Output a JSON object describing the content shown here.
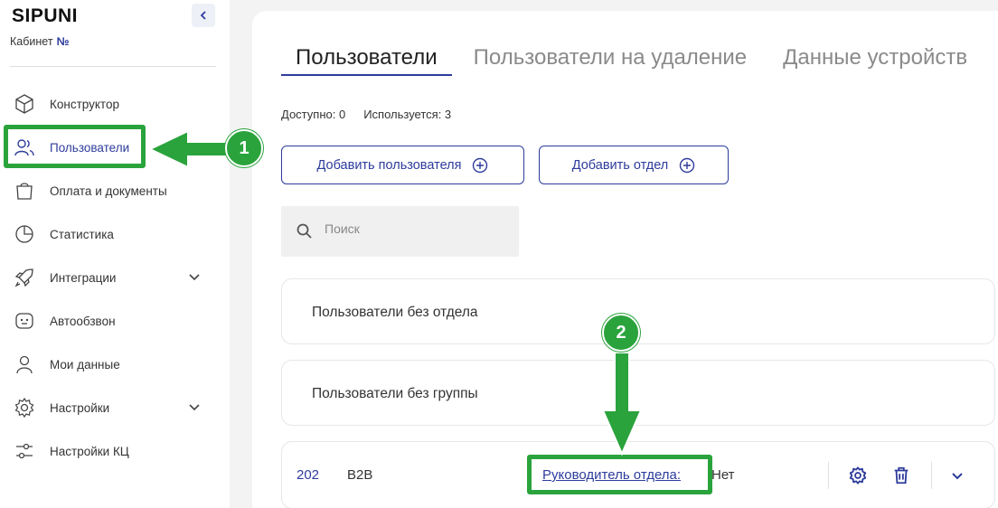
{
  "sidebar": {
    "logo": "SIPUNI",
    "cabinet_label": "Кабинет",
    "cabinet_number": "№",
    "items": [
      {
        "label": "Конструктор",
        "icon": "cube-icon"
      },
      {
        "label": "Пользователи",
        "icon": "users-icon",
        "active": true
      },
      {
        "label": "Оплата и документы",
        "icon": "shopping-bag-icon"
      },
      {
        "label": "Статистика",
        "icon": "pie-chart-icon"
      },
      {
        "label": "Интеграции",
        "icon": "rocket-icon",
        "has_submenu": true
      },
      {
        "label": "Автообзвон",
        "icon": "robot-icon"
      },
      {
        "label": "Мои данные",
        "icon": "user-icon"
      },
      {
        "label": "Настройки",
        "icon": "gear-icon",
        "has_submenu": true
      },
      {
        "label": "Настройки КЦ",
        "icon": "sliders-icon"
      }
    ]
  },
  "tabs": [
    "Пользователи",
    "Пользователи на удаление",
    "Данные устройств"
  ],
  "stats": {
    "available": "Доступно: 0",
    "used": "Используется: 3"
  },
  "buttons": {
    "add_user": "Добавить пользователя",
    "add_department": "Добавить отдел"
  },
  "search": {
    "placeholder": "Поиск"
  },
  "groups": {
    "no_department": "Пользователи без отдела",
    "no_group": "Пользователи без группы"
  },
  "department": {
    "number": "202",
    "name": "B2B",
    "head_label": "Руководитель отдела:",
    "head_value": "Нет"
  },
  "annotations": {
    "badge_1": "1",
    "badge_2": "2"
  },
  "colors": {
    "accent": "#2d3c9c",
    "highlight": "#2aa33c",
    "background": "#f3f3f3"
  }
}
